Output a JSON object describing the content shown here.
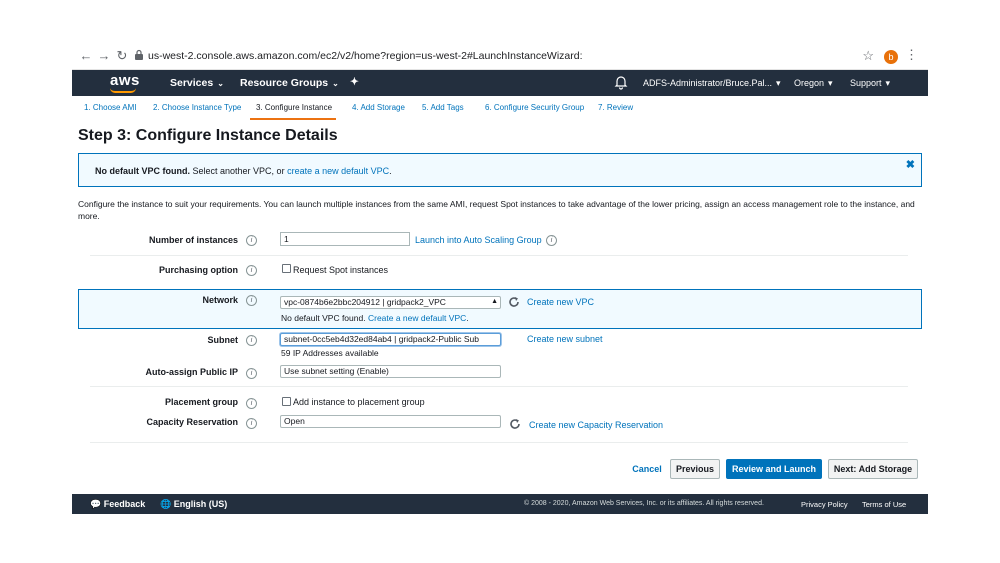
{
  "browser": {
    "url": "us-west-2.console.aws.amazon.com/ec2/v2/home?region=us-west-2#LaunchInstanceWizard:",
    "profile_initial": "b",
    "back_icon": "arrow-left-icon",
    "forward_icon": "arrow-right-icon",
    "reload_icon": "reload-icon"
  },
  "nav": {
    "logo": "aws",
    "services": "Services",
    "resource_groups": "Resource Groups",
    "account": "ADFS-Administrator/Bruce.Pal...",
    "region": "Oregon",
    "support": "Support",
    "brand_color": "#232f3e",
    "accent_color": "#ff9900"
  },
  "tabs": [
    {
      "label": "1. Choose AMI"
    },
    {
      "label": "2. Choose Instance Type"
    },
    {
      "label": "3. Configure Instance"
    },
    {
      "label": "4. Add Storage"
    },
    {
      "label": "5. Add Tags"
    },
    {
      "label": "6. Configure Security Group"
    },
    {
      "label": "7. Review"
    }
  ],
  "page": {
    "title": "Step 3: Configure Instance Details",
    "banner": {
      "bold": "No default VPC found.",
      "text": "Select another VPC, or",
      "link": "create a new default VPC",
      "suffix": "."
    },
    "description": "Configure the instance to suit your requirements. You can launch multiple instances from the same AMI, request Spot instances to take advantage of the lower pricing, assign an access management role to the instance, and more."
  },
  "form": {
    "number_of_instances": {
      "label": "Number of instances",
      "value": "1",
      "link": "Launch into Auto Scaling Group"
    },
    "purchasing_option": {
      "label": "Purchasing option",
      "checkbox": "Request Spot instances"
    },
    "network": {
      "label": "Network",
      "value": "vpc-0874b6e2bbc204912 | gridpack2_VPC",
      "link": "Create new VPC",
      "note": "No default VPC found.",
      "note_link": "Create a new default VPC",
      "note_suffix": "."
    },
    "subnet": {
      "label": "Subnet",
      "value": "subnet-0cc5eb4d32ed84ab4 | gridpack2-Public Sub",
      "link": "Create new subnet",
      "note": "59 IP Addresses available"
    },
    "auto_assign_ip": {
      "label": "Auto-assign Public IP",
      "value": "Use subnet setting (Enable)"
    },
    "placement_group": {
      "label": "Placement group",
      "checkbox": "Add instance to placement group"
    },
    "capacity_reservation": {
      "label": "Capacity Reservation",
      "value": "Open",
      "link": "Create new Capacity Reservation"
    }
  },
  "actions": {
    "cancel": "Cancel",
    "previous": "Previous",
    "review_launch": "Review and Launch",
    "next": "Next: Add Storage"
  },
  "footer": {
    "feedback": "Feedback",
    "language": "English (US)",
    "copyright": "© 2008 - 2020, Amazon Web Services, Inc. or its affiliates. All rights reserved.",
    "privacy": "Privacy Policy",
    "terms": "Terms of Use"
  }
}
